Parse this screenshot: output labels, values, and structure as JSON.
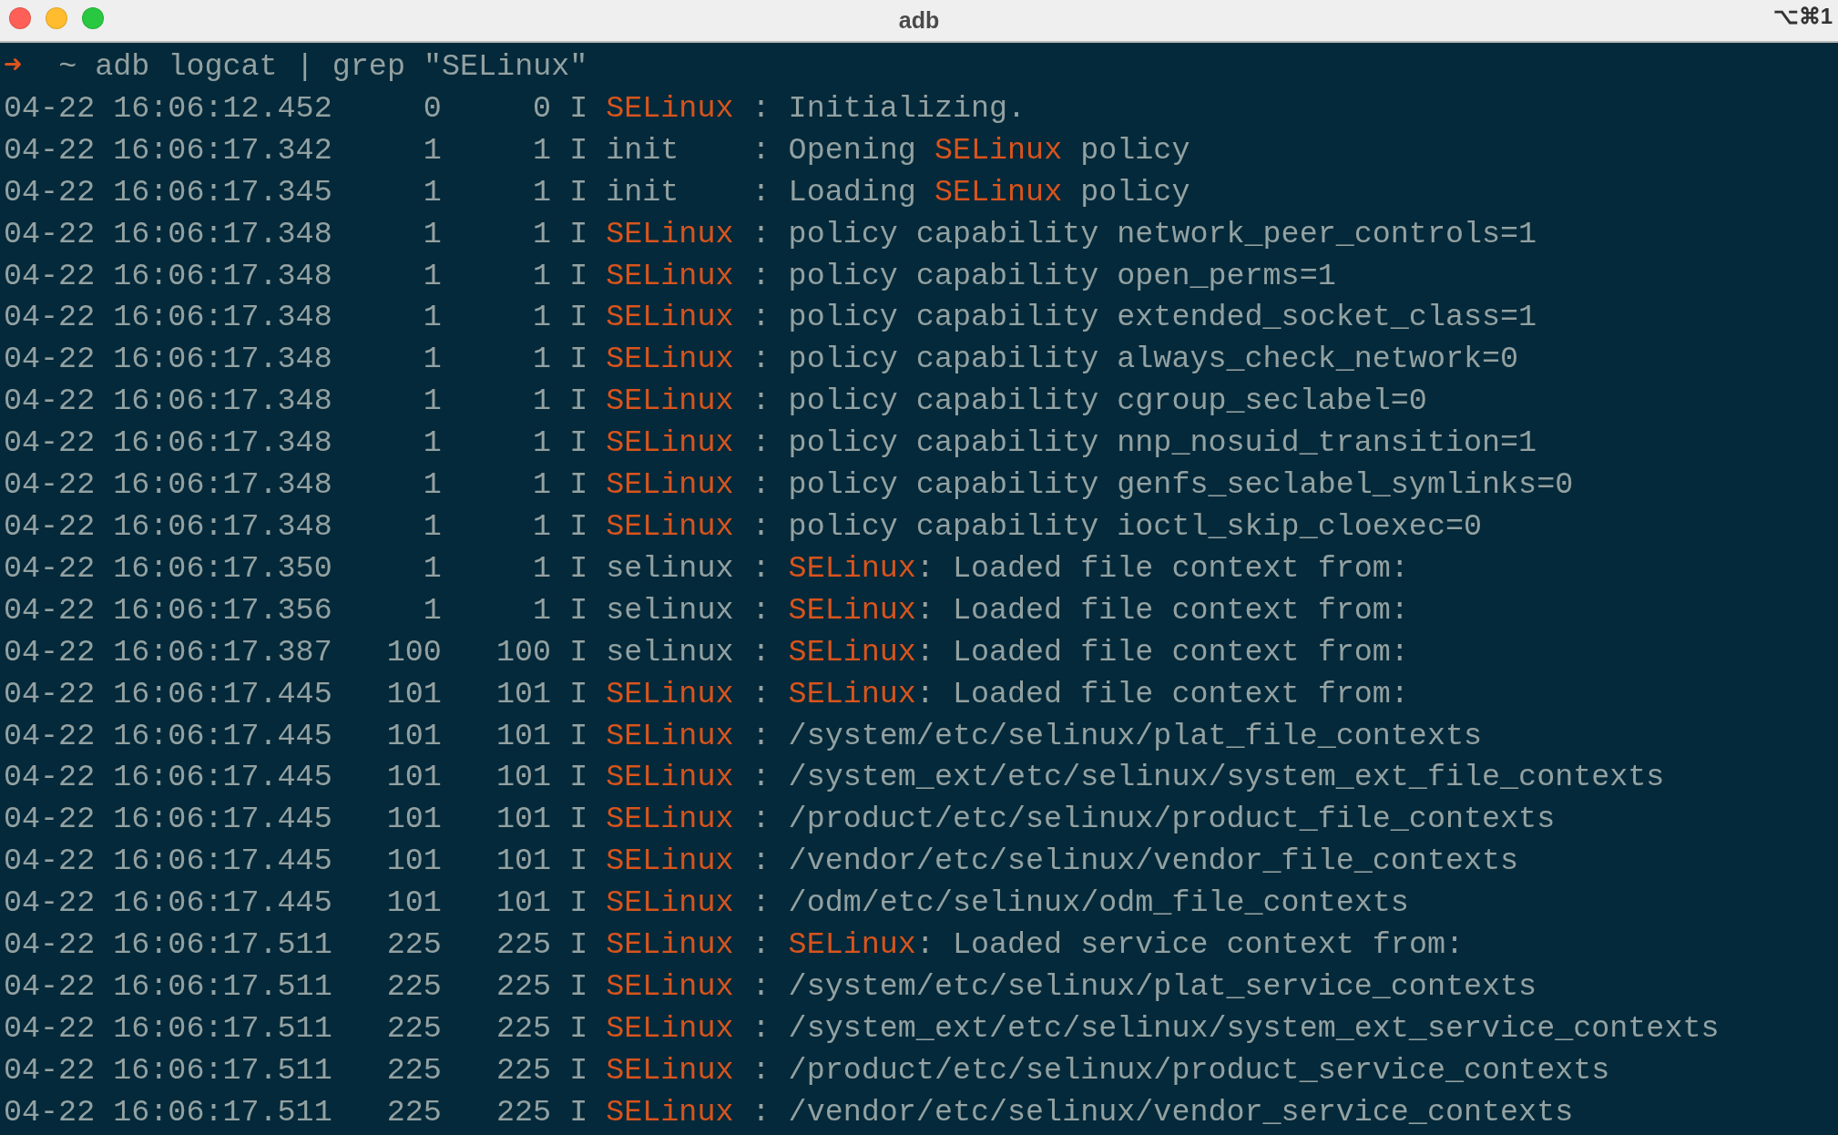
{
  "window": {
    "title": "adb",
    "shortcut": "⌥⌘1"
  },
  "prompt": {
    "arrow": "➜",
    "directory": "~",
    "command": "adb logcat | grep \"SELinux\""
  },
  "lines": [
    {
      "timestamp": "04-22 16:06:12.452",
      "pid": "0",
      "tid": "0",
      "level": "I",
      "tag": "SELinux",
      "tag_match": true,
      "message": [
        {
          "text": ": Initializing.",
          "match": false
        }
      ]
    },
    {
      "timestamp": "04-22 16:06:17.342",
      "pid": "1",
      "tid": "1",
      "level": "I",
      "tag": "init",
      "tag_match": false,
      "message": [
        {
          "text": ": Opening ",
          "match": false
        },
        {
          "text": "SELinux",
          "match": true
        },
        {
          "text": " policy",
          "match": false
        }
      ]
    },
    {
      "timestamp": "04-22 16:06:17.345",
      "pid": "1",
      "tid": "1",
      "level": "I",
      "tag": "init",
      "tag_match": false,
      "message": [
        {
          "text": ": Loading ",
          "match": false
        },
        {
          "text": "SELinux",
          "match": true
        },
        {
          "text": " policy",
          "match": false
        }
      ]
    },
    {
      "timestamp": "04-22 16:06:17.348",
      "pid": "1",
      "tid": "1",
      "level": "I",
      "tag": "SELinux",
      "tag_match": true,
      "message": [
        {
          "text": ": policy capability network_peer_controls=1",
          "match": false
        }
      ]
    },
    {
      "timestamp": "04-22 16:06:17.348",
      "pid": "1",
      "tid": "1",
      "level": "I",
      "tag": "SELinux",
      "tag_match": true,
      "message": [
        {
          "text": ": policy capability open_perms=1",
          "match": false
        }
      ]
    },
    {
      "timestamp": "04-22 16:06:17.348",
      "pid": "1",
      "tid": "1",
      "level": "I",
      "tag": "SELinux",
      "tag_match": true,
      "message": [
        {
          "text": ": policy capability extended_socket_class=1",
          "match": false
        }
      ]
    },
    {
      "timestamp": "04-22 16:06:17.348",
      "pid": "1",
      "tid": "1",
      "level": "I",
      "tag": "SELinux",
      "tag_match": true,
      "message": [
        {
          "text": ": policy capability always_check_network=0",
          "match": false
        }
      ]
    },
    {
      "timestamp": "04-22 16:06:17.348",
      "pid": "1",
      "tid": "1",
      "level": "I",
      "tag": "SELinux",
      "tag_match": true,
      "message": [
        {
          "text": ": policy capability cgroup_seclabel=0",
          "match": false
        }
      ]
    },
    {
      "timestamp": "04-22 16:06:17.348",
      "pid": "1",
      "tid": "1",
      "level": "I",
      "tag": "SELinux",
      "tag_match": true,
      "message": [
        {
          "text": ": policy capability nnp_nosuid_transition=1",
          "match": false
        }
      ]
    },
    {
      "timestamp": "04-22 16:06:17.348",
      "pid": "1",
      "tid": "1",
      "level": "I",
      "tag": "SELinux",
      "tag_match": true,
      "message": [
        {
          "text": ": policy capability genfs_seclabel_symlinks=0",
          "match": false
        }
      ]
    },
    {
      "timestamp": "04-22 16:06:17.348",
      "pid": "1",
      "tid": "1",
      "level": "I",
      "tag": "SELinux",
      "tag_match": true,
      "message": [
        {
          "text": ": policy capability ioctl_skip_cloexec=0",
          "match": false
        }
      ]
    },
    {
      "timestamp": "04-22 16:06:17.350",
      "pid": "1",
      "tid": "1",
      "level": "I",
      "tag": "selinux",
      "tag_match": false,
      "message": [
        {
          "text": ": ",
          "match": false
        },
        {
          "text": "SELinux",
          "match": true
        },
        {
          "text": ": Loaded file context from:",
          "match": false
        }
      ]
    },
    {
      "timestamp": "04-22 16:06:17.356",
      "pid": "1",
      "tid": "1",
      "level": "I",
      "tag": "selinux",
      "tag_match": false,
      "message": [
        {
          "text": ": ",
          "match": false
        },
        {
          "text": "SELinux",
          "match": true
        },
        {
          "text": ": Loaded file context from:",
          "match": false
        }
      ]
    },
    {
      "timestamp": "04-22 16:06:17.387",
      "pid": "100",
      "tid": "100",
      "level": "I",
      "tag": "selinux",
      "tag_match": false,
      "message": [
        {
          "text": ": ",
          "match": false
        },
        {
          "text": "SELinux",
          "match": true
        },
        {
          "text": ": Loaded file context from:",
          "match": false
        }
      ]
    },
    {
      "timestamp": "04-22 16:06:17.445",
      "pid": "101",
      "tid": "101",
      "level": "I",
      "tag": "SELinux",
      "tag_match": true,
      "message": [
        {
          "text": ": ",
          "match": false
        },
        {
          "text": "SELinux",
          "match": true
        },
        {
          "text": ": Loaded file context from:",
          "match": false
        }
      ]
    },
    {
      "timestamp": "04-22 16:06:17.445",
      "pid": "101",
      "tid": "101",
      "level": "I",
      "tag": "SELinux",
      "tag_match": true,
      "message": [
        {
          "text": ": /system/etc/selinux/plat_file_contexts",
          "match": false
        }
      ]
    },
    {
      "timestamp": "04-22 16:06:17.445",
      "pid": "101",
      "tid": "101",
      "level": "I",
      "tag": "SELinux",
      "tag_match": true,
      "message": [
        {
          "text": ": /system_ext/etc/selinux/system_ext_file_contexts",
          "match": false
        }
      ]
    },
    {
      "timestamp": "04-22 16:06:17.445",
      "pid": "101",
      "tid": "101",
      "level": "I",
      "tag": "SELinux",
      "tag_match": true,
      "message": [
        {
          "text": ": /product/etc/selinux/product_file_contexts",
          "match": false
        }
      ]
    },
    {
      "timestamp": "04-22 16:06:17.445",
      "pid": "101",
      "tid": "101",
      "level": "I",
      "tag": "SELinux",
      "tag_match": true,
      "message": [
        {
          "text": ": /vendor/etc/selinux/vendor_file_contexts",
          "match": false
        }
      ]
    },
    {
      "timestamp": "04-22 16:06:17.445",
      "pid": "101",
      "tid": "101",
      "level": "I",
      "tag": "SELinux",
      "tag_match": true,
      "message": [
        {
          "text": ": /odm/etc/selinux/odm_file_contexts",
          "match": false
        }
      ]
    },
    {
      "timestamp": "04-22 16:06:17.511",
      "pid": "225",
      "tid": "225",
      "level": "I",
      "tag": "SELinux",
      "tag_match": true,
      "message": [
        {
          "text": ": ",
          "match": false
        },
        {
          "text": "SELinux",
          "match": true
        },
        {
          "text": ": Loaded service context from:",
          "match": false
        }
      ]
    },
    {
      "timestamp": "04-22 16:06:17.511",
      "pid": "225",
      "tid": "225",
      "level": "I",
      "tag": "SELinux",
      "tag_match": true,
      "message": [
        {
          "text": ": /system/etc/selinux/plat_service_contexts",
          "match": false
        }
      ]
    },
    {
      "timestamp": "04-22 16:06:17.511",
      "pid": "225",
      "tid": "225",
      "level": "I",
      "tag": "SELinux",
      "tag_match": true,
      "message": [
        {
          "text": ": /system_ext/etc/selinux/system_ext_service_contexts",
          "match": false
        }
      ]
    },
    {
      "timestamp": "04-22 16:06:17.511",
      "pid": "225",
      "tid": "225",
      "level": "I",
      "tag": "SELinux",
      "tag_match": true,
      "message": [
        {
          "text": ": /product/etc/selinux/product_service_contexts",
          "match": false
        }
      ]
    },
    {
      "timestamp": "04-22 16:06:17.511",
      "pid": "225",
      "tid": "225",
      "level": "I",
      "tag": "SELinux",
      "tag_match": true,
      "message": [
        {
          "text": ": /vendor/etc/selinux/vendor_service_contexts",
          "match": false
        }
      ]
    }
  ]
}
